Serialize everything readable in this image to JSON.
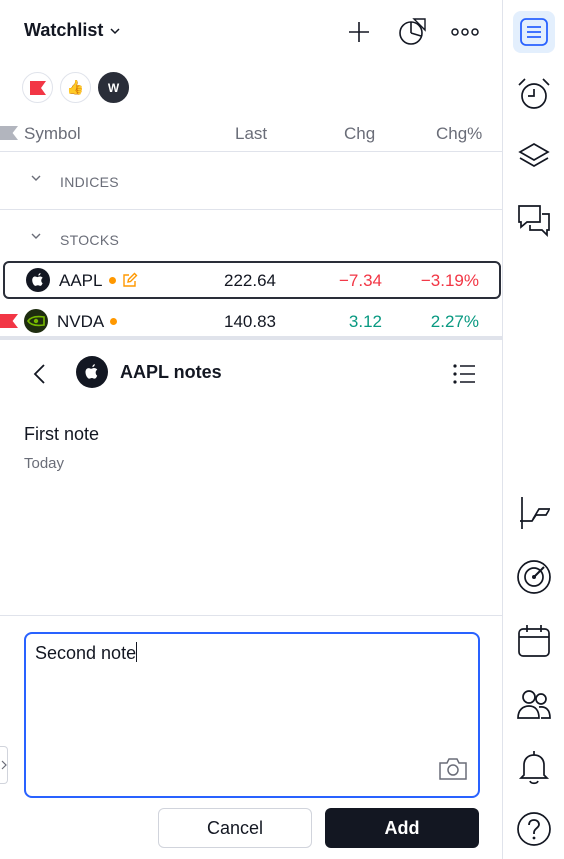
{
  "watchlist": {
    "title": "Watchlist"
  },
  "columns": {
    "symbol": "Symbol",
    "last": "Last",
    "chg": "Chg",
    "chg_pct": "Chg%"
  },
  "chips": [
    {
      "icon": "red-flag-icon"
    },
    {
      "icon": "thumbs-up-icon"
    },
    {
      "icon": "w-avatar",
      "label": "W"
    }
  ],
  "sections": [
    {
      "label": "INDICES"
    },
    {
      "label": "STOCKS"
    }
  ],
  "rows": [
    {
      "symbol": "AAPL",
      "last": "222.64",
      "chg": "−7.34",
      "chg_pct": "−3.19%",
      "change_color": "#f23645",
      "has_note": true
    },
    {
      "symbol": "NVDA",
      "last": "140.83",
      "chg": "3.12",
      "chg_pct": "2.27%",
      "change_color": "#089981",
      "flagged": true
    }
  ],
  "notes": {
    "title": "AAPL notes",
    "items": [
      {
        "text": "First note",
        "date": "Today"
      }
    ],
    "editor_value": "Second note",
    "cancel_label": "Cancel",
    "add_label": "Add"
  },
  "colors": {
    "accent": "#2962ff",
    "positive": "#089981",
    "negative": "#f23645",
    "marker": "#ff9800"
  },
  "rightbar": [
    "watchlist-icon",
    "alarm-clock-icon",
    "layers-icon",
    "chat-icon",
    "trendline-icon",
    "radar-icon",
    "calendar-icon",
    "community-icon",
    "bell-icon",
    "help-icon"
  ]
}
